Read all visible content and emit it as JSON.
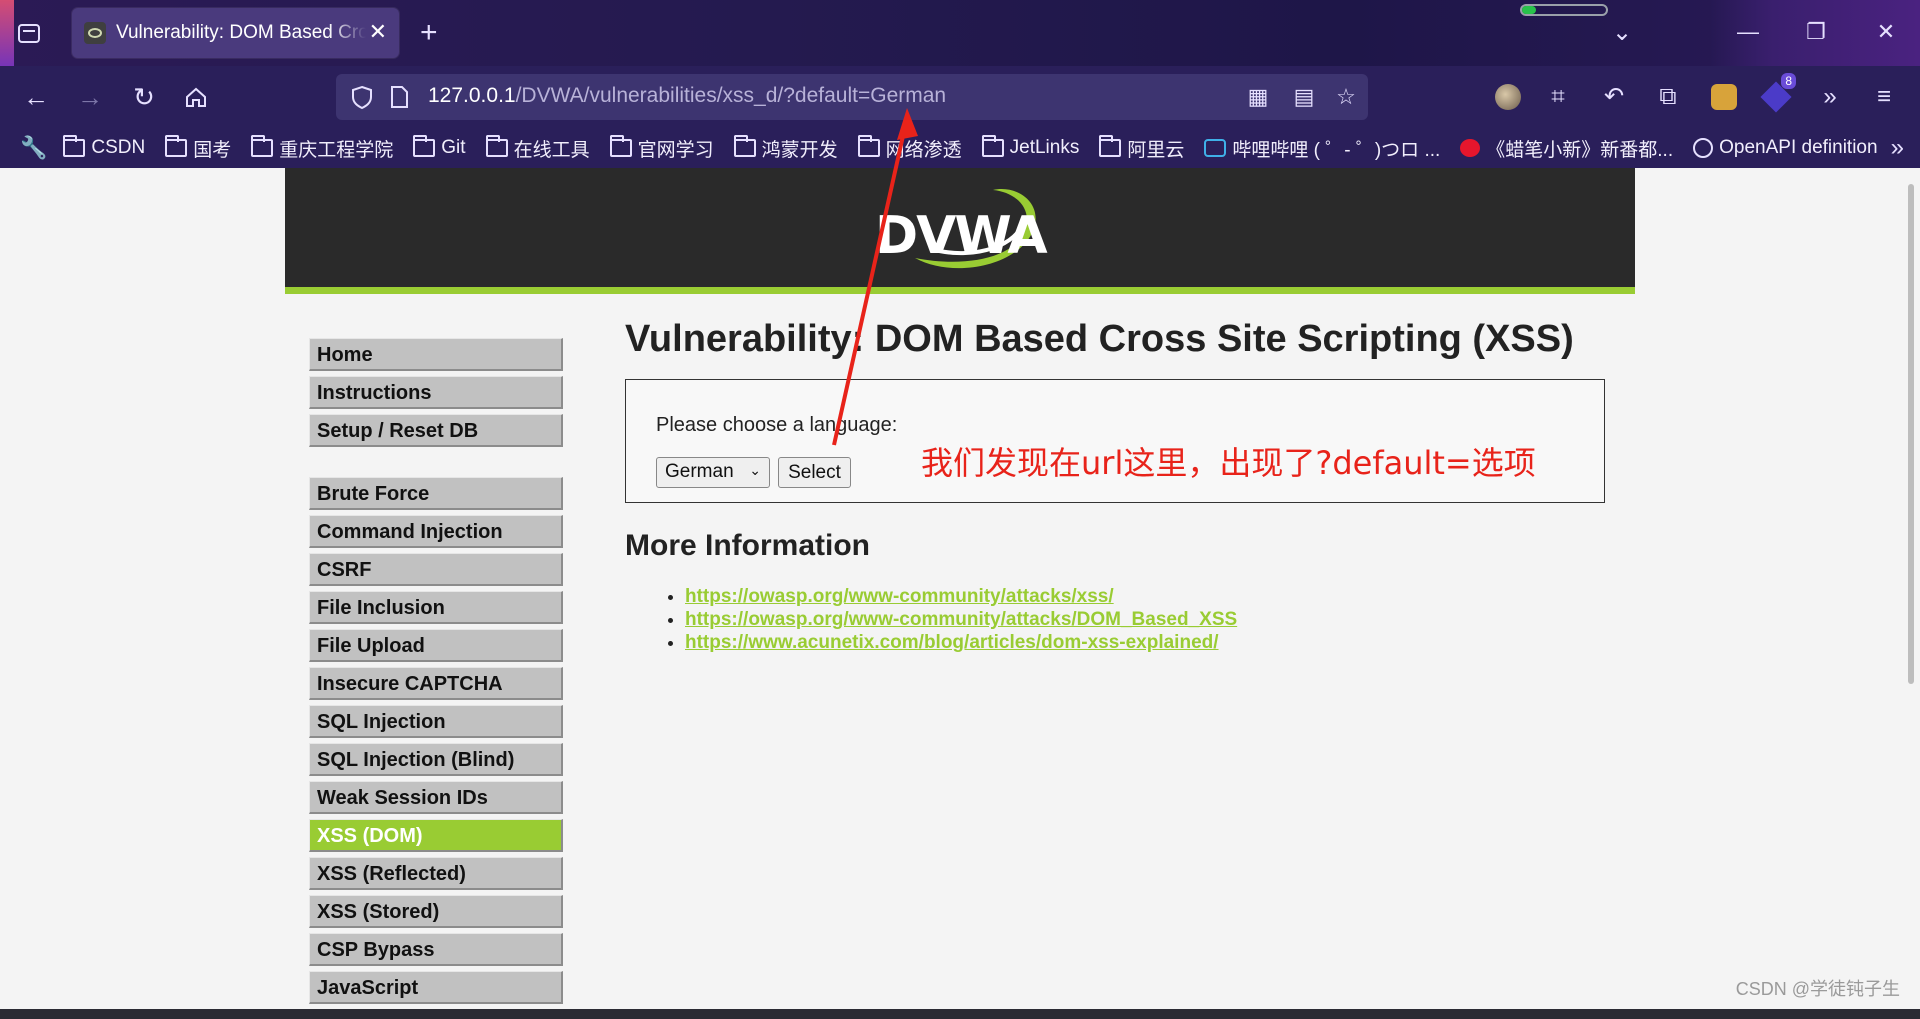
{
  "browser": {
    "tab_title": "Vulnerability: DOM Based Cross Site Scripting (XSS) :: Damn Vulnerable Web Application (DVWA)",
    "new_tab": "+",
    "url_host": "127.0.0.1",
    "url_path": "/DVWA/vulnerabilities/xss_d/?default=German",
    "extension_badge": "8",
    "bookmarks": [
      {
        "label": "CSDN",
        "icon": "folder-icon"
      },
      {
        "label": "国考",
        "icon": "folder-icon"
      },
      {
        "label": "重庆工程学院",
        "icon": "folder-icon"
      },
      {
        "label": "Git",
        "icon": "folder-icon"
      },
      {
        "label": "在线工具",
        "icon": "folder-icon"
      },
      {
        "label": "官网学习",
        "icon": "folder-icon"
      },
      {
        "label": "鸿蒙开发",
        "icon": "folder-icon"
      },
      {
        "label": "网络渗透",
        "icon": "folder-icon"
      },
      {
        "label": "JetLinks",
        "icon": "folder-icon"
      },
      {
        "label": "阿里云",
        "icon": "folder-icon"
      },
      {
        "label": "哔哩哔哩 ( ゜- ゜)つロ ...",
        "icon": "bilibili-icon"
      },
      {
        "label": "《蜡笔小新》新番都...",
        "icon": "weibo-icon"
      },
      {
        "label": "OpenAPI definition",
        "icon": "globe-icon"
      }
    ]
  },
  "dvwa": {
    "logo": "DVWA",
    "menu_group1": [
      "Home",
      "Instructions",
      "Setup / Reset DB"
    ],
    "menu_group2": [
      "Brute Force",
      "Command Injection",
      "CSRF",
      "File Inclusion",
      "File Upload",
      "Insecure CAPTCHA",
      "SQL Injection",
      "SQL Injection (Blind)",
      "Weak Session IDs",
      "XSS (DOM)",
      "XSS (Reflected)",
      "XSS (Stored)",
      "CSP Bypass",
      "JavaScript"
    ],
    "active_item": "XSS (DOM)",
    "title": "Vulnerability: DOM Based Cross Site Scripting (XSS)",
    "form_label": "Please choose a language:",
    "select_value": "German",
    "select_button": "Select",
    "more_info_heading": "More Information",
    "links": [
      "https://owasp.org/www-community/attacks/xss/",
      "https://owasp.org/www-community/attacks/DOM_Based_XSS",
      "https://www.acunetix.com/blog/articles/dom-xss-explained/"
    ],
    "accent_color": "#99cc33"
  },
  "annotation": "我们发现在url这里，出现了?default=选项",
  "watermark": "CSDN @学徒钝子生"
}
